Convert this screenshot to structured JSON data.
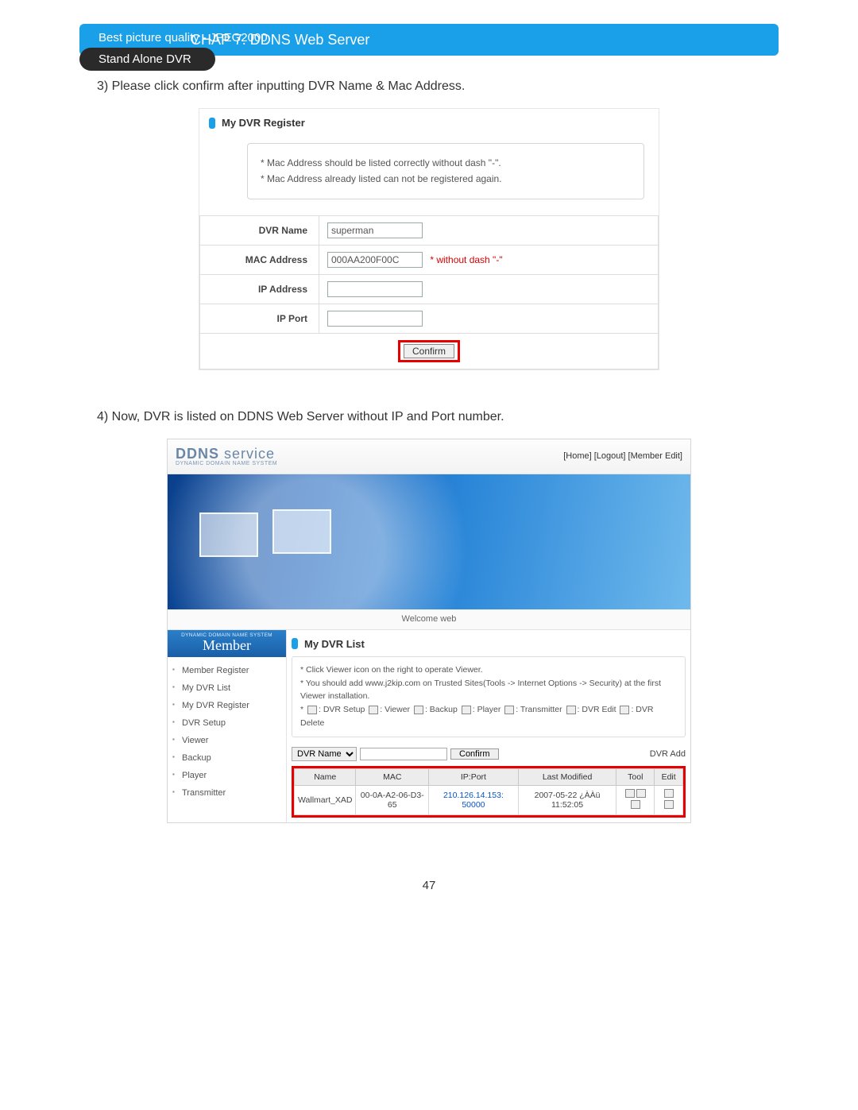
{
  "header": {
    "left": "Best picture quality -  JPEG2000",
    "right": "CHAP 7. DDNS Web Server",
    "pill": "Stand Alone DVR"
  },
  "step3": "3) Please click confirm after inputting DVR Name & Mac Address.",
  "register": {
    "title": "My DVR Register",
    "note1": "* Mac Address should be listed correctly without dash \"-\".",
    "note2": "* Mac Address already listed can not be registered again.",
    "labels": {
      "dvr_name": "DVR Name",
      "mac": "MAC Address",
      "ip": "IP Address",
      "port": "IP Port"
    },
    "values": {
      "dvr_name": "superman",
      "mac": "000AA200F00C",
      "ip": "",
      "port": ""
    },
    "mac_hint": "* without dash \"-\"",
    "confirm": "Confirm"
  },
  "step4": "4) Now, DVR is listed on DDNS Web Server without IP and Port number.",
  "ddns": {
    "logo_main": "DDNS",
    "logo_sub": " service",
    "logo_small": "DYNAMIC DOMAIN NAME SYSTEM",
    "top_links": "[Home] [Logout] [Member Edit]",
    "welcome": "Welcome web",
    "side_header_small": "DYNAMIC DOMAIN NAME SYSTEM",
    "side_header": "Member",
    "menu": [
      "Member Register",
      "My DVR List",
      "My DVR Register",
      "DVR Setup",
      "Viewer",
      "Backup",
      "Player",
      "Transmitter"
    ],
    "list_title": "My DVR List",
    "info1": "* Click Viewer icon on the right to operate Viewer.",
    "info2": "* You should add www.j2kip.com on Trusted Sites(Tools -> Internet Options -> Security) at the first Viewer installation.",
    "legend_prefix": "* ",
    "legend_items": [
      ": DVR Setup ",
      ": Viewer ",
      ": Backup ",
      ": Player ",
      ": Transmitter ",
      ": DVR Edit ",
      ": DVR Delete"
    ],
    "search_label": "DVR Name",
    "confirm_btn": "Confirm",
    "dvr_add": "DVR Add",
    "cols": [
      "Name",
      "MAC",
      "IP:Port",
      "Last Modified",
      "Tool",
      "Edit"
    ],
    "row": {
      "name": "Wallmart_XAD",
      "mac": "00-0A-A2-06-D3-65",
      "ipport": "210.126.14.153: 50000",
      "modified": "2007-05-22 ¿ÀÀü 11:52:05"
    }
  },
  "page_number": "47"
}
